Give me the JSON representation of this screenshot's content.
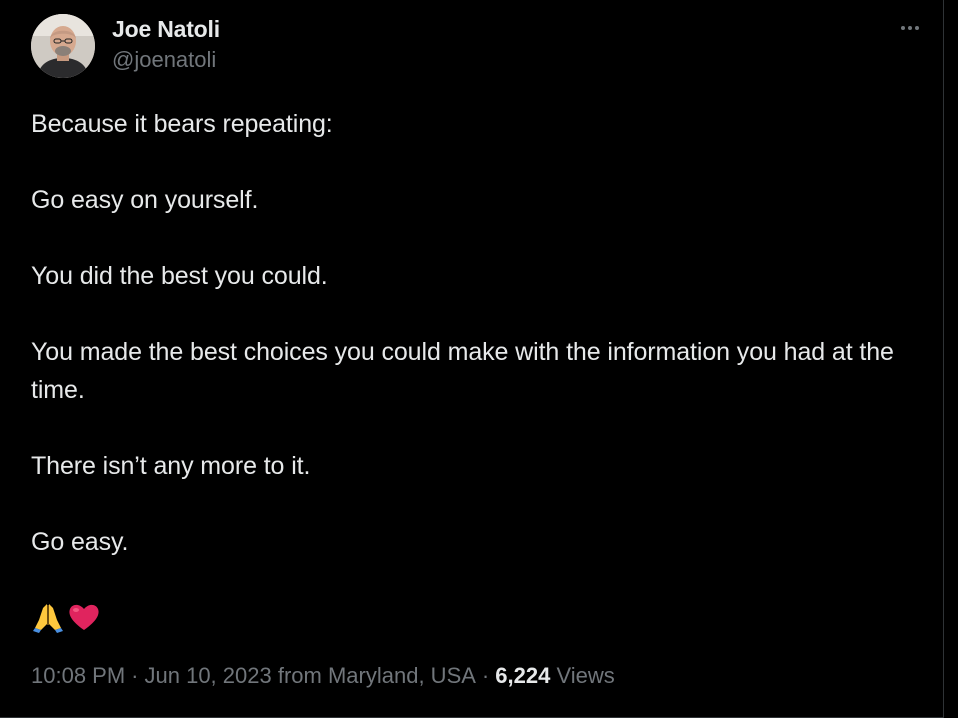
{
  "author": {
    "display_name": "Joe Natoli",
    "handle": "@joenatoli",
    "avatar_icon": "profile-photo"
  },
  "menu": {
    "icon": "more-icon"
  },
  "tweet": {
    "paragraphs": [
      "Because it bears repeating:",
      "Go easy on yourself.",
      "You did the best you could.",
      "You made the best choices you could make with the information you had at the time.",
      "There isn’t any more to it.",
      "Go easy."
    ],
    "emojis": [
      "folded-hands-emoji",
      "red-heart-emoji"
    ]
  },
  "meta": {
    "time": "10:08 PM",
    "separator": "·",
    "date": "Jun 10, 2023",
    "location": "from Maryland, USA",
    "views_count": "6,224",
    "views_label": "Views"
  },
  "colors": {
    "background": "#000000",
    "text_primary": "#e7e9ea",
    "text_secondary": "#71767b",
    "border": "#2f3336",
    "heart": "#e0245e"
  }
}
